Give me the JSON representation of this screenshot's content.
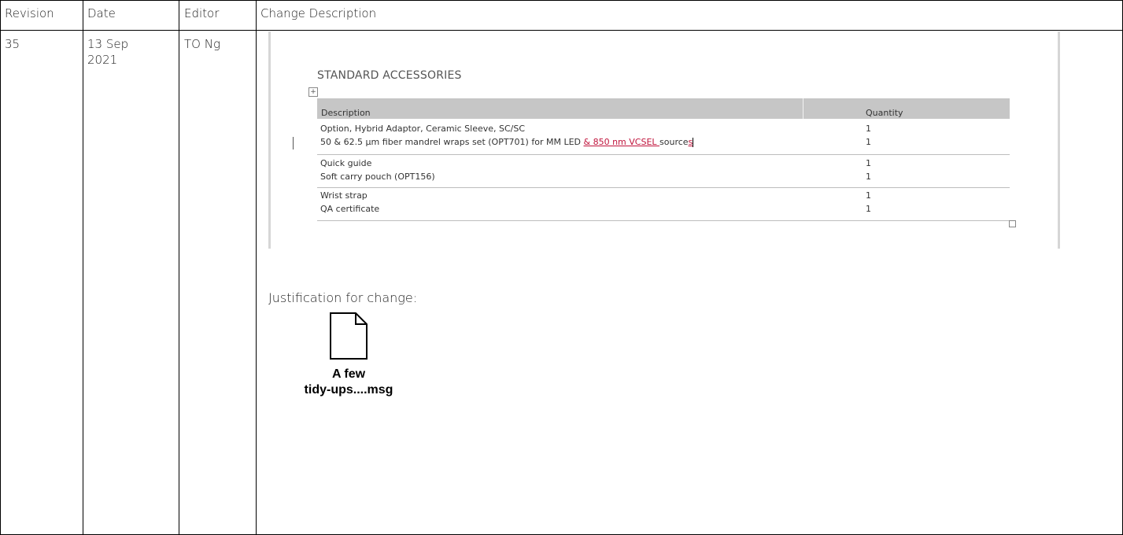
{
  "table": {
    "headers": [
      "Revision",
      "Date",
      "Editor",
      "Change Description"
    ],
    "rows": [
      {
        "revision": "35",
        "date_line1": "13 Sep",
        "date_line2": "2021",
        "editor": "TO Ng"
      }
    ]
  },
  "snippet": {
    "title": "STANDARD ACCESSORIES",
    "columns": [
      "Description",
      "Quantity"
    ],
    "items": [
      {
        "desc": "Option, Hybrid Adaptor, Ceramic Sleeve, SC/SC",
        "qty": "1"
      },
      {
        "desc_before": "50 & 62.5 µm fiber mandrel wraps set (OPT701) for MM LED ",
        "desc_insert": "& 850 nm  VCSEL ",
        "desc_after": "source",
        "desc_insert2": "s",
        "qty": "1"
      },
      {
        "desc": "Quick guide",
        "qty": "1"
      },
      {
        "desc": "Soft carry pouch (OPT156)",
        "qty": "1"
      },
      {
        "desc": "Wrist strap",
        "qty": "1"
      },
      {
        "desc": "QA certificate",
        "qty": "1"
      }
    ]
  },
  "justification_label": "Justification for change:",
  "attachment": {
    "icon": "document-icon",
    "name_line1": "A few",
    "name_line2": "tidy-ups....msg"
  },
  "colors": {
    "tracked_insert": "#c0143c",
    "table_header_bg": "#c6c6c6"
  }
}
